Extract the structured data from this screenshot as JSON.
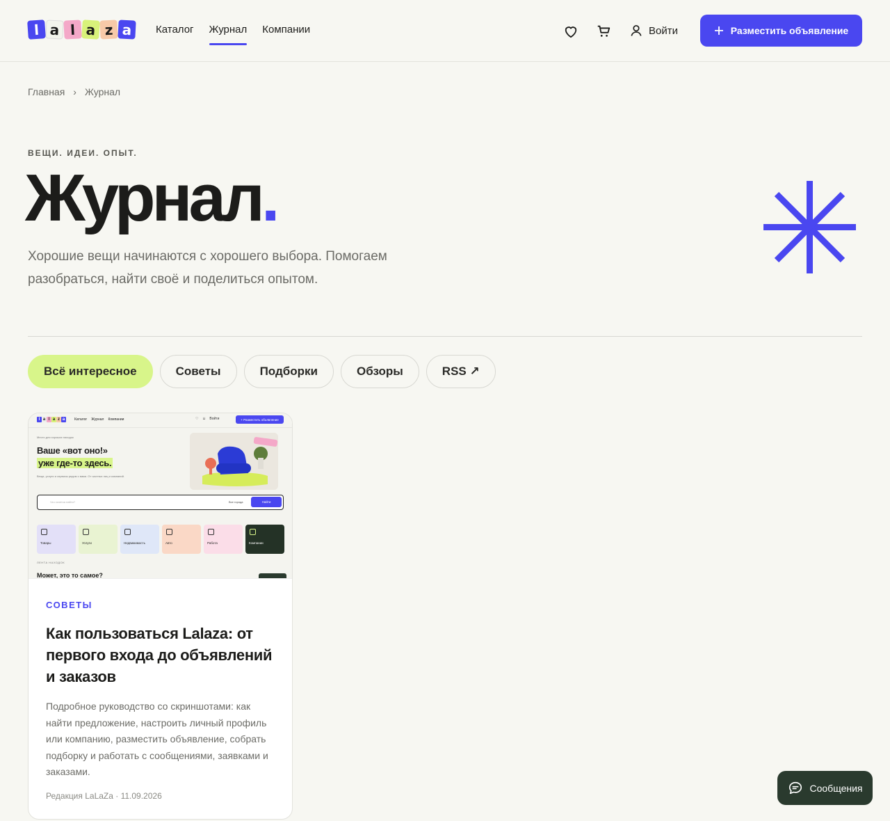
{
  "header": {
    "logo_letters": [
      "l",
      "a",
      "l",
      "a",
      "z",
      "a"
    ],
    "nav": [
      "Каталог",
      "Журнал",
      "Компании"
    ],
    "favorites_icon": "heart-icon",
    "cart_icon": "cart-icon",
    "login_label": "Войти",
    "post_button": "Разместить объявление"
  },
  "breadcrumb": {
    "home": "Главная",
    "separator": "›",
    "current": "Журнал"
  },
  "hero": {
    "eyebrow": "ВЕЩИ. ИДЕИ. ОПЫТ.",
    "title": "Журнал",
    "title_dot": ".",
    "lead": "Хорошие вещи начинаются с хорошего выбора. Помогаем разобраться, найти своё и поделиться опытом.",
    "accent_color": "#4a47f0"
  },
  "filters": [
    "Всё интересное",
    "Советы",
    "Подборки",
    "Обзоры",
    "RSS ↗"
  ],
  "card": {
    "category": "СОВЕТЫ",
    "title": "Как пользоваться Lalaza: от первого входа до объявлений и заказов",
    "description": "Подробное руководство со скриншотами: как найти предложение, настроить личный профиль или компанию, разместить объявление, собрать подборку и работать с сообщениями, заявками и заказами.",
    "meta": "Редакция LaLaZa · 11.09.2026",
    "screenshot": {
      "nav": [
        "Каталог",
        "Журнал",
        "Компании"
      ],
      "login": "Войти",
      "post_button": "+ Разместить объявление",
      "tagline": "Место для хороших находок",
      "heading_line1": "Ваше «вот оно!»",
      "heading_line2": "уже где-то здесь.",
      "subtitle": "Вещи, услуги и сервисы рядом с вами. От частных лиц и компаний.",
      "search_placeholder": "Что хочется найти?",
      "search_location": "Все города",
      "search_button": "Найти",
      "tiles": [
        "Товары",
        "Услуги",
        "Недвижимость",
        "Авто",
        "Работа",
        "Компании"
      ],
      "feed_label": "ЛЕНТА НАХОДОК",
      "feed_title": "Может, это то самое?"
    }
  },
  "messages_button": "Сообщения"
}
